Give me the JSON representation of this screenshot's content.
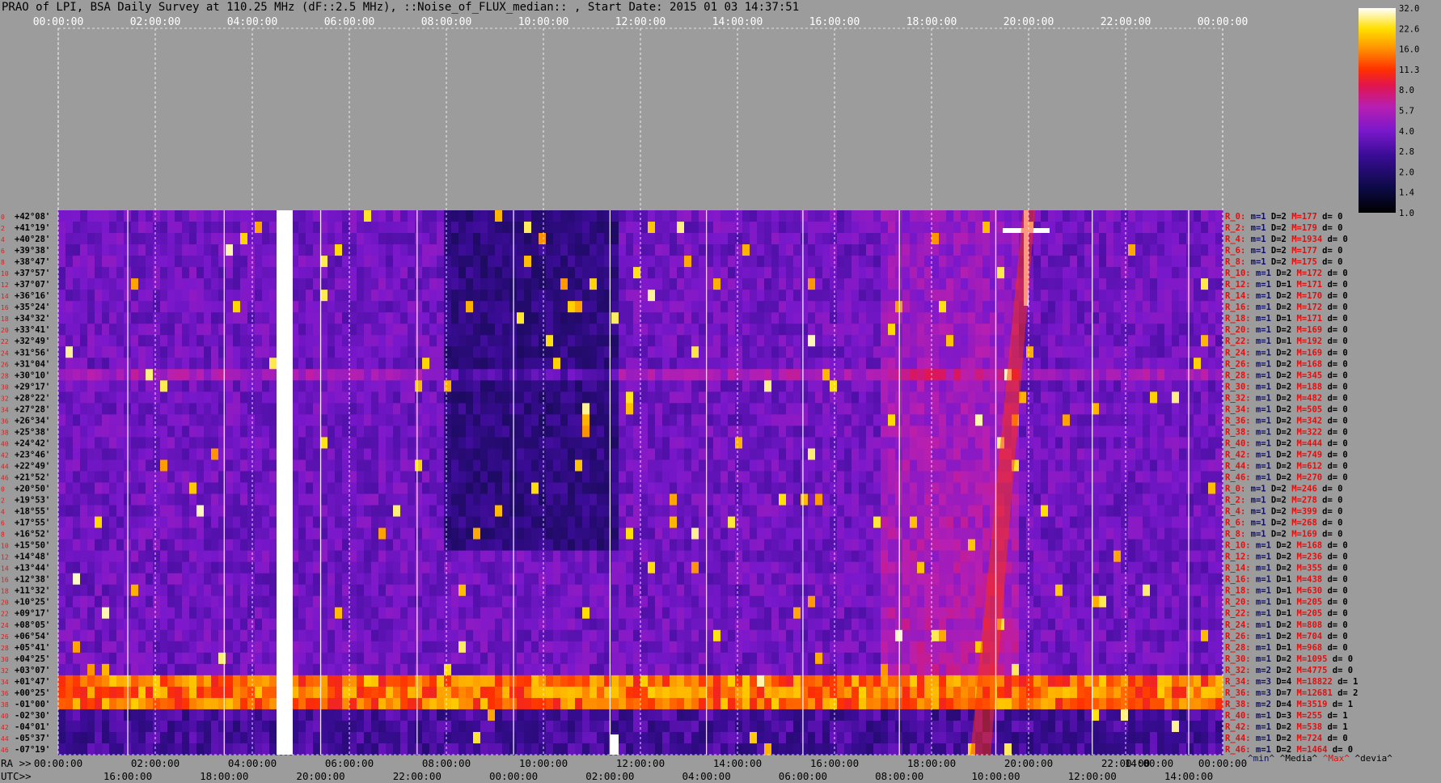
{
  "title": "PRAO of LPI, BSA Daily Survey at 110.25 MHz (dF::2.5 MHz), ::Noise_of_FLUX_median:: , Start Date: 2015 01 03 14:37:51",
  "chart_data": {
    "type": "heatmap",
    "top_ticks": [
      "00:00:00",
      "02:00:00",
      "04:00:00",
      "06:00:00",
      "08:00:00",
      "10:00:00",
      "12:00:00",
      "14:00:00",
      "16:00:00",
      "18:00:00",
      "20:00:00",
      "22:00:00",
      "00:00:00"
    ],
    "bottom_prefix_ra": "RA >>",
    "bottom_prefix_utc": "UTC>>",
    "bottom_ra_ticks": [
      "00:00:00",
      "02:00:00",
      "04:00:00",
      "06:00:00",
      "08:00:00",
      "10:00:00",
      "12:00:00",
      "14:00:00",
      "16:00:00",
      "18:00:00",
      "20:00:00",
      "22:00:00",
      "14:00:00",
      "00:00:00"
    ],
    "bottom_utc_ticks": [
      "16:00:00",
      "18:00:00",
      "20:00:00",
      "22:00:00",
      "00:00:00",
      "02:00:00",
      "04:00:00",
      "06:00:00",
      "08:00:00",
      "10:00:00",
      "12:00:00",
      "14:00:00"
    ],
    "declinations": [
      "+42°08'",
      "+41°19'",
      "+40°28'",
      "+39°38'",
      "+38°47'",
      "+37°57'",
      "+37°07'",
      "+36°16'",
      "+35°24'",
      "+34°32'",
      "+33°41'",
      "+32°49'",
      "+31°56'",
      "+31°04'",
      "+30°10'",
      "+29°17'",
      "+28°22'",
      "+27°28'",
      "+26°34'",
      "+25°38'",
      "+24°42'",
      "+23°46'",
      "+22°49'",
      "+21°52'",
      "+20°50'",
      "+19°53'",
      "+18°55'",
      "+17°55'",
      "+16°52'",
      "+15°50'",
      "+14°48'",
      "+13°44'",
      "+12°38'",
      "+11°32'",
      "+10°25'",
      "+09°17'",
      "+08°05'",
      "+06°54'",
      "+05°41'",
      "+04°25'",
      "+03°07'",
      "+01°47'",
      "+00°25'",
      "-01°00'",
      "-02°30'",
      "-04°01'",
      "-05°37'",
      "-07°19'"
    ],
    "row_index_labels": [
      "0",
      "2",
      "4",
      "6",
      "8",
      "10",
      "12",
      "14",
      "16",
      "18",
      "20",
      "22",
      "24",
      "26",
      "28",
      "30",
      "32",
      "34",
      "36",
      "38",
      "40",
      "42",
      "44",
      "46",
      "0",
      "2",
      "4",
      "6",
      "8",
      "10",
      "12",
      "14",
      "16",
      "18",
      "20",
      "22",
      "24",
      "26",
      "28",
      "30",
      "32",
      "34",
      "36",
      "38",
      "40",
      "42",
      "44",
      "46"
    ],
    "rows": [
      {
        "r": "R_0:",
        "m": "m=1",
        "d": "D=2",
        "M": "M=177",
        "dv": "d= 0"
      },
      {
        "r": "R_2:",
        "m": "m=1",
        "d": "D=2",
        "M": "M=179",
        "dv": "d= 0"
      },
      {
        "r": "R_4:",
        "m": "m=1",
        "d": "D=2",
        "M": "M=1934",
        "dv": "d= 0"
      },
      {
        "r": "R_6:",
        "m": "m=1",
        "d": "D=2",
        "M": "M=177",
        "dv": "d= 0"
      },
      {
        "r": "R_8:",
        "m": "m=1",
        "d": "D=2",
        "M": "M=175",
        "dv": "d= 0"
      },
      {
        "r": "R_10:",
        "m": "m=1",
        "d": "D=2",
        "M": "M=172",
        "dv": "d= 0"
      },
      {
        "r": "R_12:",
        "m": "m=1",
        "d": "D=1",
        "M": "M=171",
        "dv": "d= 0"
      },
      {
        "r": "R_14:",
        "m": "m=1",
        "d": "D=2",
        "M": "M=170",
        "dv": "d= 0"
      },
      {
        "r": "R_16:",
        "m": "m=1",
        "d": "D=2",
        "M": "M=172",
        "dv": "d= 0"
      },
      {
        "r": "R_18:",
        "m": "m=1",
        "d": "D=1",
        "M": "M=171",
        "dv": "d= 0"
      },
      {
        "r": "R_20:",
        "m": "m=1",
        "d": "D=2",
        "M": "M=169",
        "dv": "d= 0"
      },
      {
        "r": "R_22:",
        "m": "m=1",
        "d": "D=1",
        "M": "M=192",
        "dv": "d= 0"
      },
      {
        "r": "R_24:",
        "m": "m=1",
        "d": "D=2",
        "M": "M=169",
        "dv": "d= 0"
      },
      {
        "r": "R_26:",
        "m": "m=1",
        "d": "D=2",
        "M": "M=168",
        "dv": "d= 0"
      },
      {
        "r": "R_28:",
        "m": "m=1",
        "d": "D=2",
        "M": "M=345",
        "dv": "d= 0"
      },
      {
        "r": "R_30:",
        "m": "m=1",
        "d": "D=2",
        "M": "M=188",
        "dv": "d= 0"
      },
      {
        "r": "R_32:",
        "m": "m=1",
        "d": "D=2",
        "M": "M=482",
        "dv": "d= 0"
      },
      {
        "r": "R_34:",
        "m": "m=1",
        "d": "D=2",
        "M": "M=505",
        "dv": "d= 0"
      },
      {
        "r": "R_36:",
        "m": "m=1",
        "d": "D=2",
        "M": "M=342",
        "dv": "d= 0"
      },
      {
        "r": "R_38:",
        "m": "m=1",
        "d": "D=2",
        "M": "M=322",
        "dv": "d= 0"
      },
      {
        "r": "R_40:",
        "m": "m=1",
        "d": "D=2",
        "M": "M=444",
        "dv": "d= 0"
      },
      {
        "r": "R_42:",
        "m": "m=1",
        "d": "D=2",
        "M": "M=749",
        "dv": "d= 0"
      },
      {
        "r": "R_44:",
        "m": "m=1",
        "d": "D=2",
        "M": "M=612",
        "dv": "d= 0"
      },
      {
        "r": "R_46:",
        "m": "m=1",
        "d": "D=2",
        "M": "M=270",
        "dv": "d= 0"
      },
      {
        "r": "R_0:",
        "m": "m=1",
        "d": "D=2",
        "M": "M=246",
        "dv": "d= 0"
      },
      {
        "r": "R_2:",
        "m": "m=1",
        "d": "D=2",
        "M": "M=278",
        "dv": "d= 0"
      },
      {
        "r": "R_4:",
        "m": "m=1",
        "d": "D=2",
        "M": "M=399",
        "dv": "d= 0"
      },
      {
        "r": "R_6:",
        "m": "m=1",
        "d": "D=2",
        "M": "M=268",
        "dv": "d= 0"
      },
      {
        "r": "R_8:",
        "m": "m=1",
        "d": "D=2",
        "M": "M=169",
        "dv": "d= 0"
      },
      {
        "r": "R_10:",
        "m": "m=1",
        "d": "D=2",
        "M": "M=168",
        "dv": "d= 0"
      },
      {
        "r": "R_12:",
        "m": "m=1",
        "d": "D=2",
        "M": "M=236",
        "dv": "d= 0"
      },
      {
        "r": "R_14:",
        "m": "m=1",
        "d": "D=2",
        "M": "M=355",
        "dv": "d= 0"
      },
      {
        "r": "R_16:",
        "m": "m=1",
        "d": "D=1",
        "M": "M=438",
        "dv": "d= 0"
      },
      {
        "r": "R_18:",
        "m": "m=1",
        "d": "D=1",
        "M": "M=630",
        "dv": "d= 0"
      },
      {
        "r": "R_20:",
        "m": "m=1",
        "d": "D=1",
        "M": "M=205",
        "dv": "d= 0"
      },
      {
        "r": "R_22:",
        "m": "m=1",
        "d": "D=1",
        "M": "M=205",
        "dv": "d= 0"
      },
      {
        "r": "R_24:",
        "m": "m=1",
        "d": "D=2",
        "M": "M=808",
        "dv": "d= 0"
      },
      {
        "r": "R_26:",
        "m": "m=1",
        "d": "D=2",
        "M": "M=704",
        "dv": "d= 0"
      },
      {
        "r": "R_28:",
        "m": "m=1",
        "d": "D=1",
        "M": "M=968",
        "dv": "d= 0"
      },
      {
        "r": "R_30:",
        "m": "m=1",
        "d": "D=2",
        "M": "M=1095",
        "dv": "d= 0"
      },
      {
        "r": "R_32:",
        "m": "m=2",
        "d": "D=2",
        "M": "M=4775",
        "dv": "d= 0"
      },
      {
        "r": "R_34:",
        "m": "m=3",
        "d": "D=4",
        "M": "M=18822",
        "dv": "d= 1"
      },
      {
        "r": "R_36:",
        "m": "m=3",
        "d": "D=7",
        "M": "M=12681",
        "dv": "d= 2"
      },
      {
        "r": "R_38:",
        "m": "m=2",
        "d": "D=4",
        "M": "M=3519",
        "dv": "d= 1"
      },
      {
        "r": "R_40:",
        "m": "m=1",
        "d": "D=3",
        "M": "M=255",
        "dv": "d= 1"
      },
      {
        "r": "R_42:",
        "m": "m=1",
        "d": "D=2",
        "M": "M=538",
        "dv": "d= 1"
      },
      {
        "r": "R_44:",
        "m": "m=1",
        "d": "D=2",
        "M": "M=724",
        "dv": "d= 0"
      },
      {
        "r": "R_46:",
        "m": "m=1",
        "d": "D=2",
        "M": "M=1464",
        "dv": "d= 0"
      }
    ],
    "legend": {
      "min": "^min^",
      "median": "^Media^",
      "max": "^Max^",
      "dev": "^devia^"
    },
    "colorbar": {
      "ticks": [
        "32.0",
        "22.6",
        "16.0",
        "11.3",
        "8.0",
        "5.7",
        "4.0",
        "2.8",
        "2.0",
        "1.4",
        "1.0"
      ],
      "scale": "log"
    },
    "colors": {
      "background": "#9c9c9c",
      "grid": "#ffffff",
      "label_red": "#e01010"
    }
  }
}
